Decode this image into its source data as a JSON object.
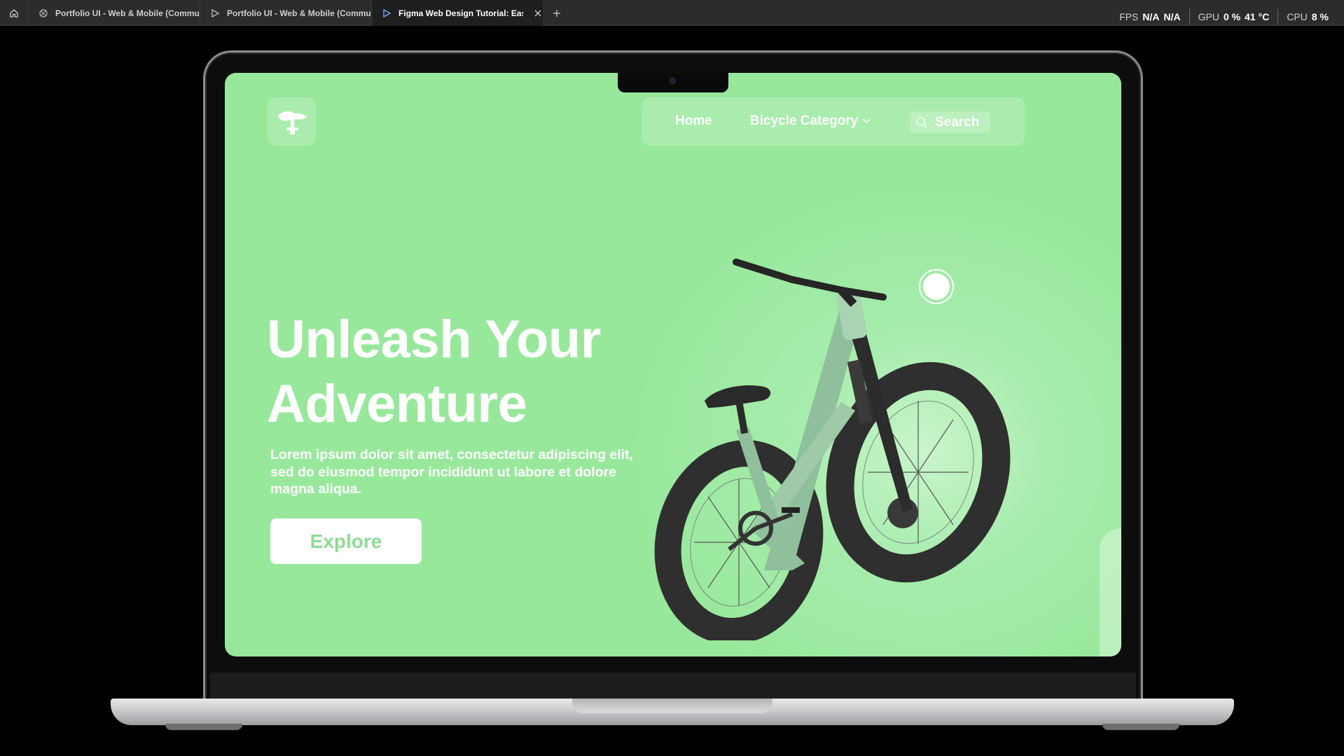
{
  "browser": {
    "tabs": [
      {
        "label": "Portfolio UI - Web & Mobile (Commun",
        "icon": "component-icon",
        "active": false
      },
      {
        "label": "Portfolio UI - Web & Mobile (Commun",
        "icon": "play-icon",
        "active": false
      },
      {
        "label": "Figma Web Design Tutorial: Easy",
        "icon": "play-icon",
        "active": true
      }
    ]
  },
  "stats": {
    "fps_label": "FPS",
    "fps_value_1": "N/A",
    "fps_value_2": "N/A",
    "gpu_label": "GPU",
    "gpu_usage": "0 %",
    "gpu_temp": "41 °C",
    "cpu_label": "CPU",
    "cpu_usage": "8 %"
  },
  "site": {
    "logo_icon": "bike-saddle-icon",
    "nav": {
      "home": "Home",
      "category": "Bicycle Category",
      "search": "Search"
    },
    "hero": {
      "headline_line1": "Unleash Your",
      "headline_line2": "Adventure",
      "body": "Lorem ipsum dolor sit amet, consectetur adipiscing elit, sed do eiusmod tempor incididunt ut labore et dolore magna aliqua.",
      "cta": "Explore"
    }
  },
  "colors": {
    "hero_bg": "#98e89c",
    "cta_text": "#8edc93",
    "bike_frame": "#8fbf9b"
  }
}
